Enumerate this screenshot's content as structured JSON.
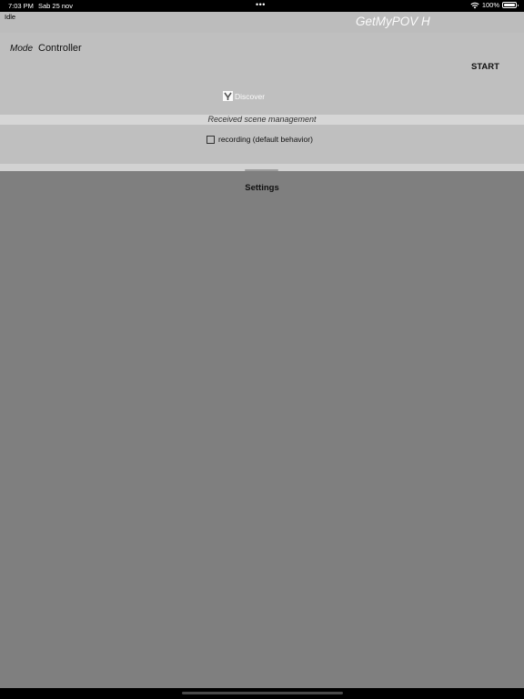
{
  "statusbar": {
    "time": "7:03 PM",
    "date": "Sab 25 nov",
    "dots": "•••",
    "battery": "100%"
  },
  "header": {
    "status": "Idle",
    "title": "GetMyPOV H"
  },
  "panel": {
    "mode_label": "Mode",
    "mode_value": "Controller",
    "start_label": "START",
    "discover_label": "Discover",
    "discover_checked": true
  },
  "scene": {
    "section_label": "Received scene management",
    "recording_label": "recording (default behavior)",
    "recording_checked": false
  },
  "settings": {
    "title": "Settings"
  }
}
